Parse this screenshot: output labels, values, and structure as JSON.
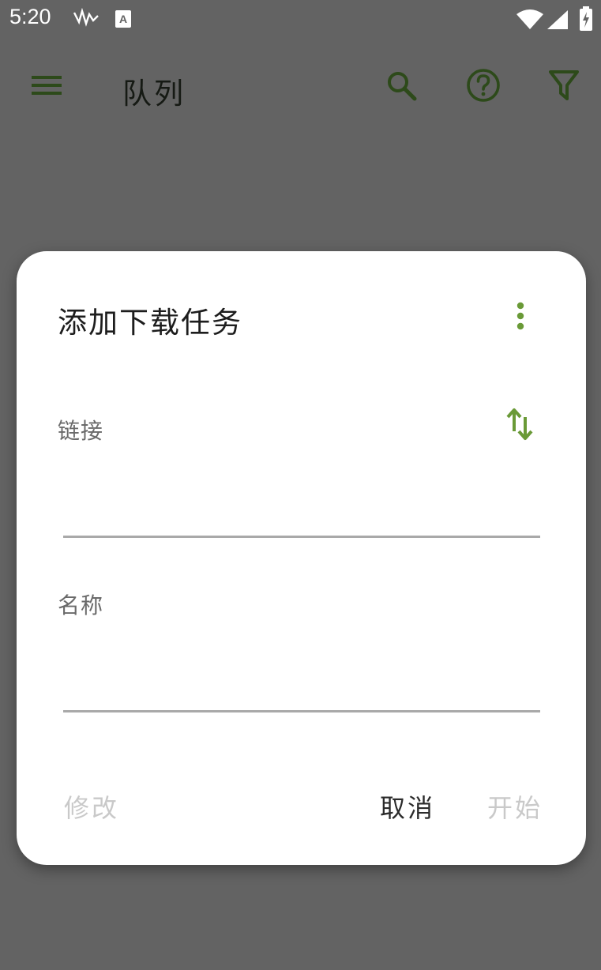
{
  "status_bar": {
    "time": "5:20",
    "icons": [
      "signal-trace-icon",
      "keyboard-a-icon",
      "wifi-icon",
      "cell-signal-icon",
      "battery-charging-icon"
    ]
  },
  "toolbar": {
    "title": "队列",
    "menu_icon": "menu-icon",
    "search_icon": "search-icon",
    "help_icon": "help-circle-icon",
    "filter_icon": "filter-icon"
  },
  "dialog": {
    "title": "添加下载任务",
    "link": {
      "label": "链接",
      "value": ""
    },
    "name": {
      "label": "名称",
      "value": ""
    },
    "actions": {
      "modify": "修改",
      "cancel": "取消",
      "start": "开始"
    }
  },
  "colors": {
    "accent": "#6a9a37",
    "toolbar_icon": "#2d4a1a",
    "scrim_background": "#636363",
    "dialog_background": "#ffffff",
    "disabled_text": "#c9c9c9"
  }
}
